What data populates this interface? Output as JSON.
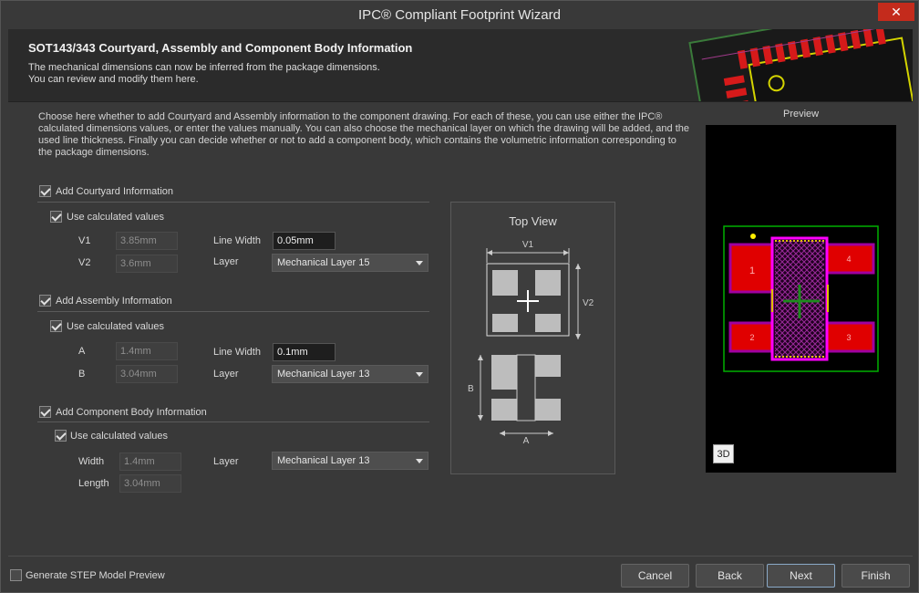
{
  "window": {
    "title": "IPC® Compliant Footprint Wizard",
    "close_glyph": "✕"
  },
  "header": {
    "title": "SOT143/343 Courtyard, Assembly and Component Body Information",
    "line1": "The mechanical dimensions can now be inferred from the package dimensions.",
    "line2": "You can review and modify them here."
  },
  "intro": "Choose here whether to add Courtyard and Assembly information to the component drawing. For each of these, you can use either the IPC® calculated dimensions values, or enter the values manually. You can also choose the mechanical layer on which the drawing will be added, and the used line thickness. Finally you can decide whether or not to add a component body, which contains the volumetric information corresponding to the package dimensions.",
  "courtyard": {
    "label": "Add Courtyard Information",
    "checked": true,
    "use_calc_label": "Use calculated values",
    "use_calc_checked": true,
    "v1_label": "V1",
    "v1_value": "3.85mm",
    "v2_label": "V2",
    "v2_value": "3.6mm",
    "line_width_label": "Line Width",
    "line_width_value": "0.05mm",
    "layer_label": "Layer",
    "layer_value": "Mechanical Layer 15"
  },
  "assembly": {
    "label": "Add Assembly Information",
    "checked": true,
    "use_calc_label": "Use calculated values",
    "use_calc_checked": true,
    "a_label": "A",
    "a_value": "1.4mm",
    "b_label": "B",
    "b_value": "3.04mm",
    "line_width_label": "Line Width",
    "line_width_value": "0.1mm",
    "layer_label": "Layer",
    "layer_value": "Mechanical Layer 13"
  },
  "body": {
    "label": "Add Component Body Information",
    "checked": true,
    "use_calc_label": "Use calculated values",
    "use_calc_checked": true,
    "width_label": "Width",
    "width_value": "1.4mm",
    "length_label": "Length",
    "length_value": "3.04mm",
    "layer_label": "Layer",
    "layer_value": "Mechanical Layer 13"
  },
  "topview": {
    "title": "Top View",
    "v1": "V1",
    "v2": "V2",
    "a": "A",
    "b": "B"
  },
  "preview": {
    "label": "Preview",
    "button_3d": "3D",
    "pads": [
      "1",
      "2",
      "3",
      "4"
    ],
    "colors": {
      "pad": "#ff0000",
      "pad_outline": "#c000c0",
      "courtyard": "#00c000",
      "dot": "#ffff00"
    }
  },
  "footer": {
    "step_label": "Generate STEP Model Preview",
    "step_checked": false,
    "cancel": "Cancel",
    "back": "Back",
    "next": "Next",
    "finish": "Finish"
  }
}
